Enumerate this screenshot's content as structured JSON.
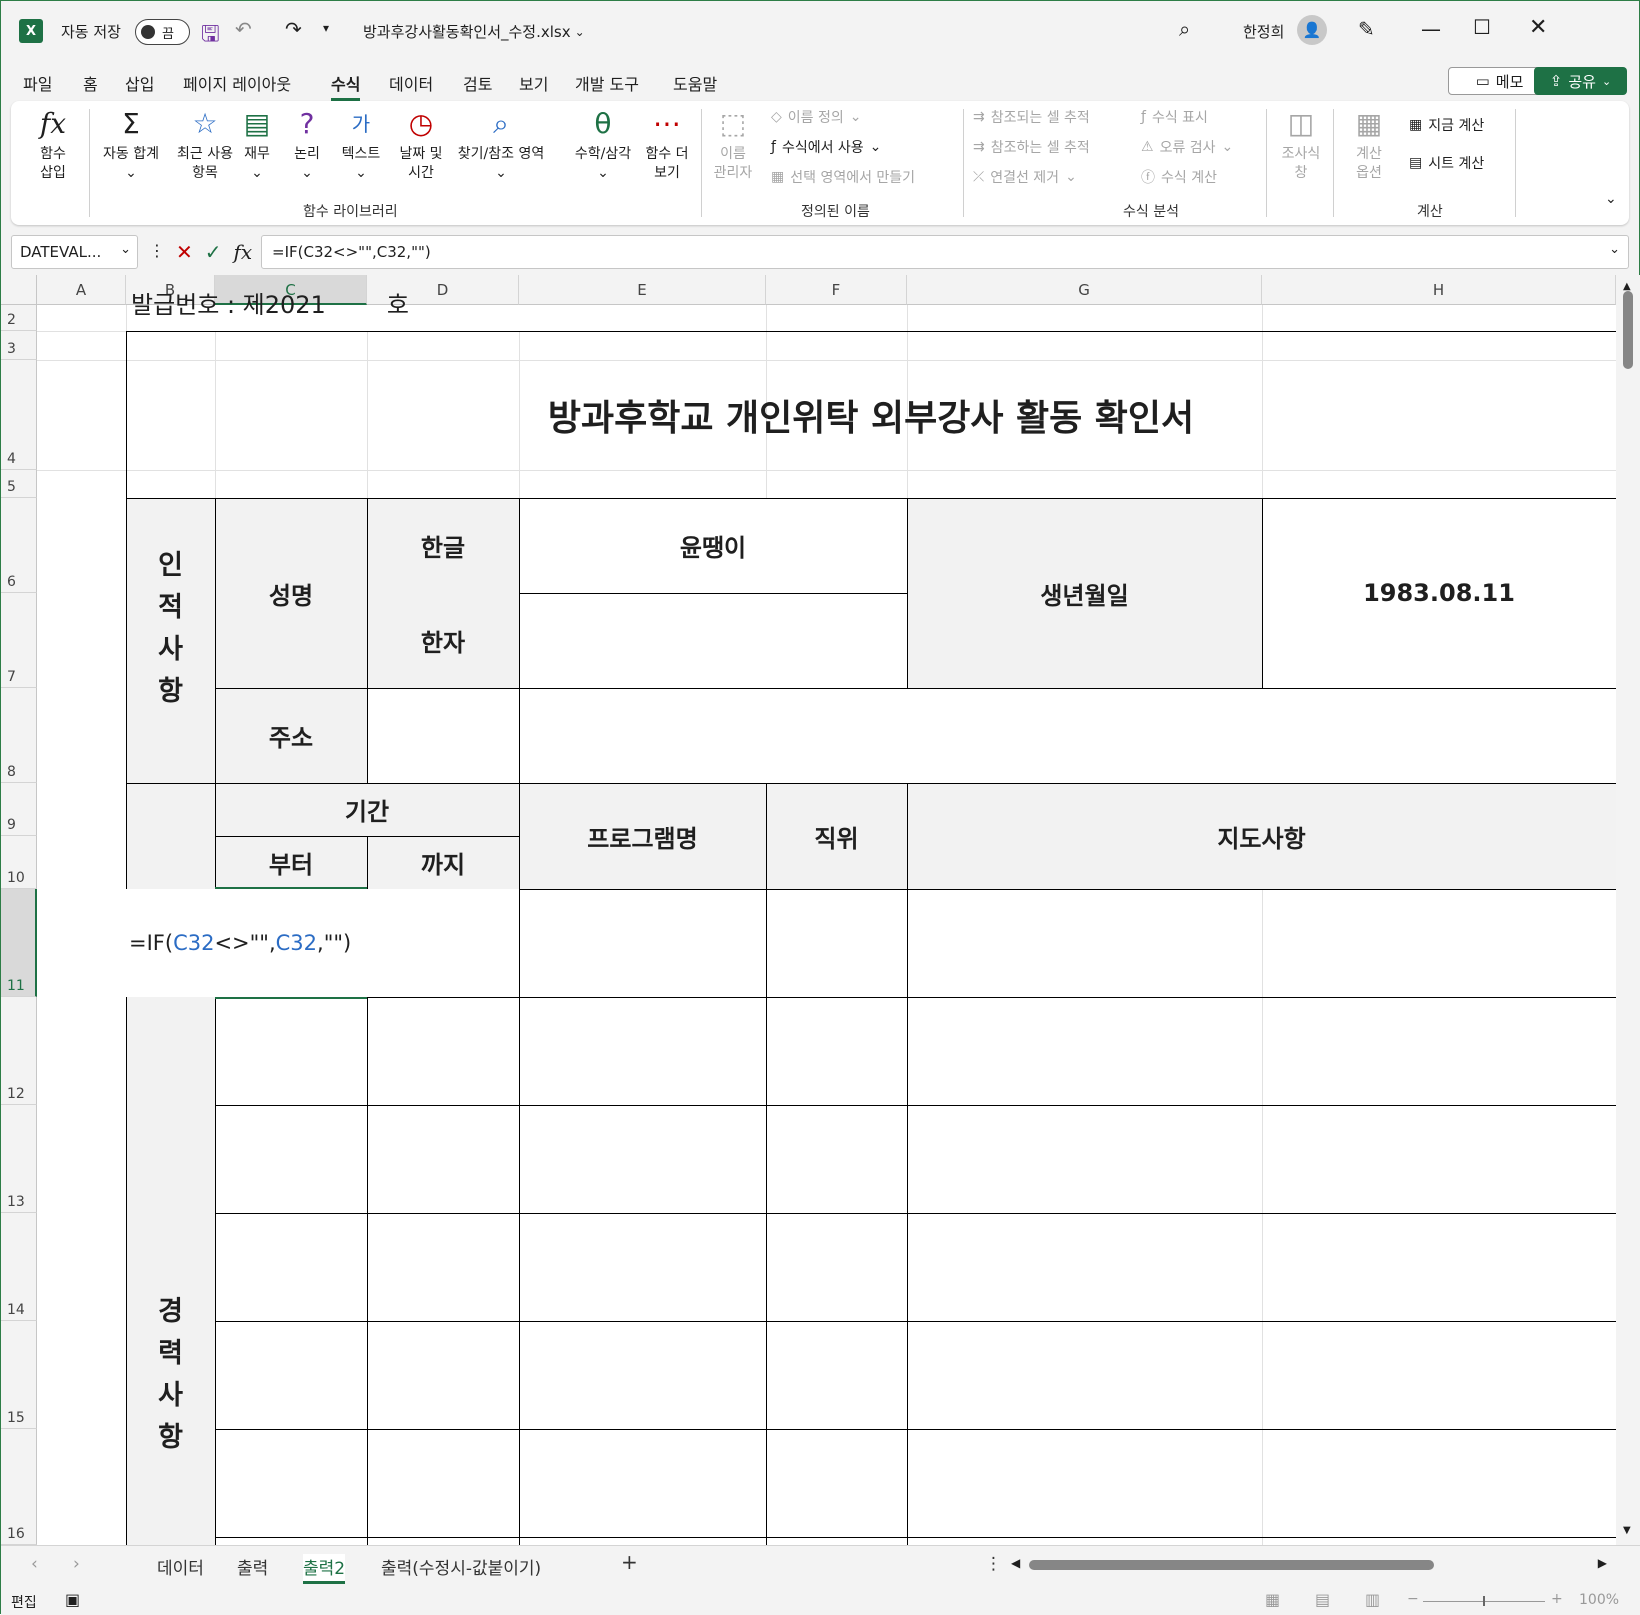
{
  "titlebar": {
    "autosave_label": "자동 저장",
    "autosave_state": "끔",
    "filename": "방과후강사활동확인서_수정.xlsx",
    "user": "한정희"
  },
  "menu": [
    "파일",
    "홈",
    "삽입",
    "페이지 레이아웃",
    "수식",
    "데이터",
    "검토",
    "보기",
    "개발 도구",
    "도움말"
  ],
  "menu_active": "수식",
  "buttons": {
    "memo": "메모",
    "share": "공유"
  },
  "ribbon": {
    "insert_function": "함수\n삽입",
    "autosum": "자동 합계",
    "recent": "최근 사용\n항목",
    "financial": "재무",
    "logical": "논리",
    "text": "텍스트",
    "datetime": "날짜 및\n시간",
    "lookup": "찾기/참조 영역",
    "math": "수학/삼각",
    "more": "함수 더\n보기",
    "group_library": "함수 라이브러리",
    "name_manager": "이름\n관리자",
    "define_name": "이름 정의",
    "use_in_formula": "수식에서 사용",
    "create_from_sel": "선택 영역에서 만들기",
    "group_names": "정의된 이름",
    "trace_precedents": "참조되는 셀 추적",
    "trace_dependents": "참조하는 셀 추적",
    "remove_arrows": "연결선 제거",
    "show_formulas": "수식 표시",
    "error_check": "오류 검사",
    "evaluate": "수식 계산",
    "group_audit": "수식 분석",
    "watch": "조사식\n창",
    "calc_options": "계산\n옵션",
    "calc_now": "지금 계산",
    "calc_sheet": "시트 계산",
    "group_calc": "계산"
  },
  "formula_bar": {
    "name_box": "DATEVAL...",
    "formula": "=IF(C32<>\"\",C32,\"\")"
  },
  "columns": [
    "A",
    "B",
    "C",
    "D",
    "E",
    "F",
    "G",
    "H"
  ],
  "rows": [
    "2",
    "3",
    "4",
    "5",
    "6",
    "7",
    "8",
    "9",
    "10",
    "11",
    "12",
    "13",
    "14",
    "15",
    "16"
  ],
  "sheet": {
    "partial_top": "발급번호 : 제2021        호",
    "title": "방과후학교 개인위탁 외부강사 활동 확인서",
    "section_personal": "인\n적\n사\n항",
    "name_label": "성명",
    "hangul_label": "한글",
    "hanja_label": "한자",
    "name_value": "윤땡이",
    "birth_label": "생년월일",
    "birth_value": "1983.08.11",
    "address_label": "주소",
    "period_label": "기간",
    "from_label": "부터",
    "to_label": "까지",
    "program_label": "프로그램명",
    "position_label": "직위",
    "guidance_label": "지도사항",
    "edit_formula_prefix": "=IF(",
    "edit_ref1": "C32",
    "edit_mid": "<>\"\",",
    "edit_ref2": "C32",
    "edit_suffix": ",\"\")",
    "section_career": "경\n력\n사\n항"
  },
  "tabs": [
    "데이터",
    "출력",
    "출력2",
    "출력(수정시-값붙이기)"
  ],
  "tab_active": "출력2",
  "status": {
    "mode": "편집",
    "zoom": "100%"
  }
}
